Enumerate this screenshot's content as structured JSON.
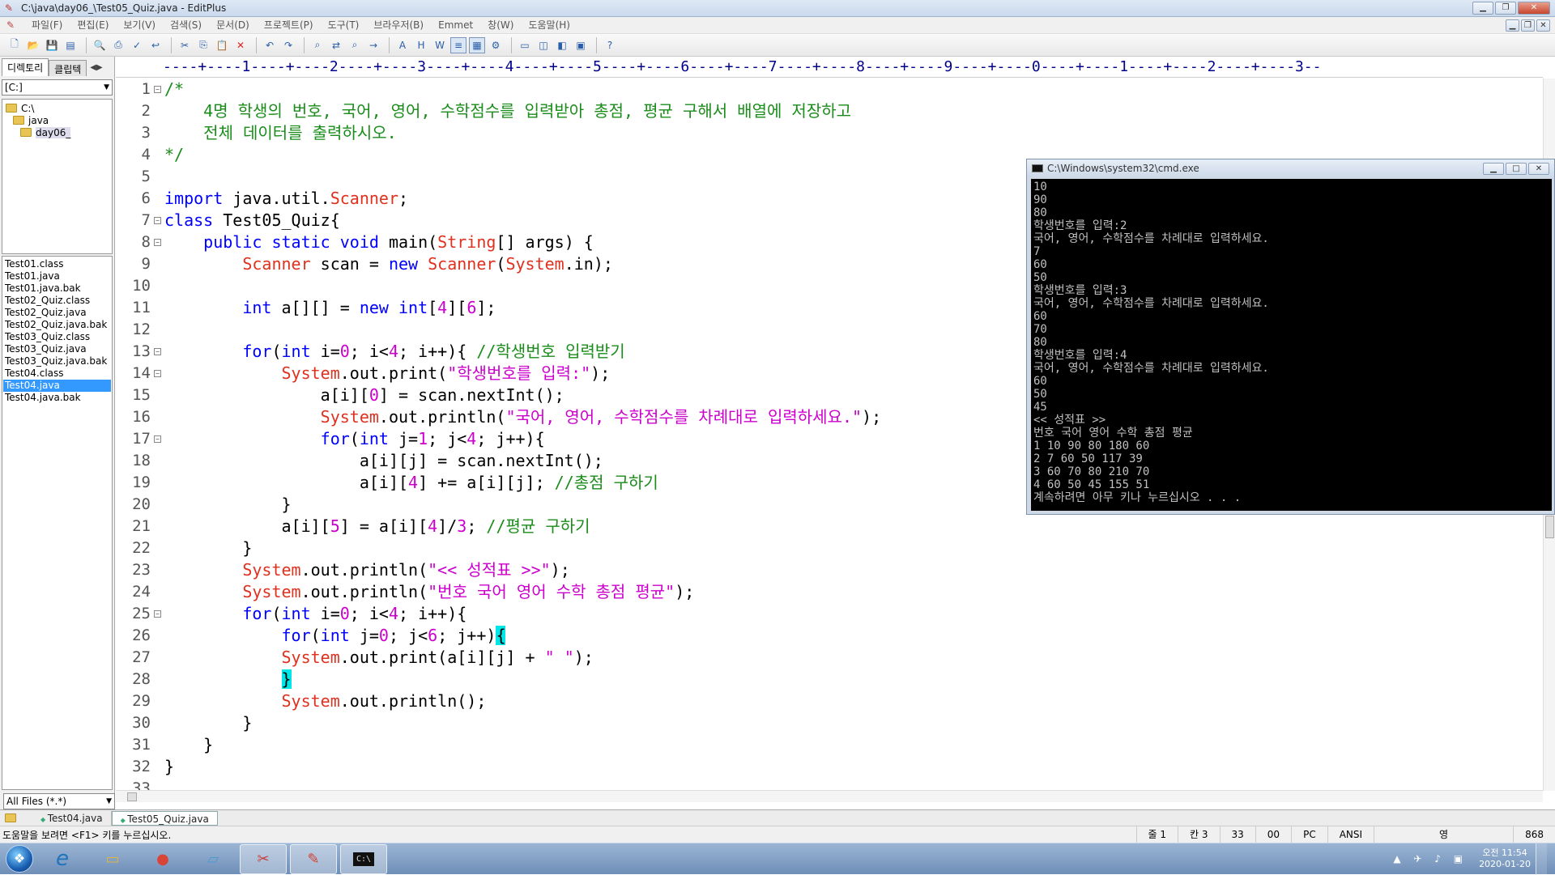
{
  "window": {
    "title": "C:\\java\\day06_\\Test05_Quiz.java - EditPlus",
    "icon": "editplus-pencil-icon"
  },
  "menu": [
    "파일(F)",
    "편집(E)",
    "보기(V)",
    "검색(S)",
    "문서(D)",
    "프로젝트(P)",
    "도구(T)",
    "브라우저(B)",
    "Emmet",
    "창(W)",
    "도움말(H)"
  ],
  "toolbar": {
    "icons": [
      "new-file-icon",
      "open-file-icon",
      "save-icon",
      "save-all-icon",
      "sep",
      "print-preview-icon",
      "print-icon",
      "spell-check-icon",
      "word-wrap-icon",
      "sep",
      "cut-icon",
      "copy-icon",
      "paste-icon",
      "delete-icon",
      "sep",
      "undo-icon",
      "redo-icon",
      "sep",
      "find-icon",
      "replace-icon",
      "find-in-files-icon",
      "goto-icon",
      "sep",
      "font-icon",
      "hex-icon",
      "wordwrap-icon",
      "line-number-icon",
      "column-select-icon",
      "settings-icon",
      "sep",
      "layout-icon",
      "split-icon",
      "browser-icon",
      "output-icon",
      "sep",
      "help-icon"
    ]
  },
  "sidebar": {
    "tabs": [
      "디렉토리",
      "클립텍"
    ],
    "tab_nav": "◀▶",
    "drive": "[C:]",
    "tree": [
      {
        "label": "C:\\",
        "level": 0
      },
      {
        "label": "java",
        "level": 1
      },
      {
        "label": "day06_",
        "level": 2
      }
    ],
    "files": [
      "Test01.class",
      "Test01.java",
      "Test01.java.bak",
      "Test02_Quiz.class",
      "Test02_Quiz.java",
      "Test02_Quiz.java.bak",
      "Test03_Quiz.class",
      "Test03_Quiz.java",
      "Test03_Quiz.java.bak",
      "Test04.class",
      "Test04.java",
      "Test04.java.bak"
    ],
    "selected_file": "Test04.java",
    "filter": "All Files (*.*)"
  },
  "editor": {
    "ruler": "----+----1----+----2----+----3----+----4----+----5----+----6----+----7----+----8----+----9----+----0----+----1----+----2----+----3--",
    "line_numbers": [
      "1",
      "2",
      "3",
      "4",
      "5",
      "6",
      "7",
      "8",
      "9",
      "10",
      "11",
      "12",
      "13",
      "14",
      "15",
      "16",
      "17",
      "18",
      "19",
      "20",
      "21",
      "22",
      "23",
      "24",
      "25",
      "26",
      "27",
      "28",
      "29",
      "30",
      "31",
      "32",
      "33"
    ],
    "fold_lines": [
      1,
      7,
      8,
      13,
      14,
      17,
      25
    ],
    "lines": [
      [
        [
          "cm",
          "/*"
        ]
      ],
      [
        [
          "cm",
          "    4명 학생의 번호, 국어, 영어, 수학점수를 입력받아 총점, 평균 구해서 배열에 저장하고"
        ]
      ],
      [
        [
          "cm",
          "    전체 데이터를 출력하시오."
        ]
      ],
      [
        [
          "cm",
          "*/"
        ]
      ],
      [],
      [
        [
          "kw",
          "import"
        ],
        [
          "p",
          " java.util."
        ],
        [
          "cls",
          "Scanner"
        ],
        [
          "p",
          ";"
        ]
      ],
      [
        [
          "kw",
          "class"
        ],
        [
          "p",
          " Test05_Quiz{"
        ]
      ],
      [
        [
          "p",
          "    "
        ],
        [
          "kw",
          "public static void"
        ],
        [
          "p",
          " main("
        ],
        [
          "cls",
          "String"
        ],
        [
          "p",
          "[] args) {"
        ]
      ],
      [
        [
          "p",
          "        "
        ],
        [
          "cls",
          "Scanner"
        ],
        [
          "p",
          " scan = "
        ],
        [
          "kw",
          "new"
        ],
        [
          "p",
          " "
        ],
        [
          "cls",
          "Scanner"
        ],
        [
          "p",
          "("
        ],
        [
          "cls",
          "System"
        ],
        [
          "p",
          ".in);"
        ]
      ],
      [],
      [
        [
          "p",
          "        "
        ],
        [
          "kw",
          "int"
        ],
        [
          "p",
          " a[][] = "
        ],
        [
          "kw",
          "new int"
        ],
        [
          "p",
          "["
        ],
        [
          "num",
          "4"
        ],
        [
          "p",
          "]["
        ],
        [
          "num",
          "6"
        ],
        [
          "p",
          "];"
        ]
      ],
      [],
      [
        [
          "p",
          "        "
        ],
        [
          "kw",
          "for"
        ],
        [
          "p",
          "("
        ],
        [
          "kw",
          "int"
        ],
        [
          "p",
          " i="
        ],
        [
          "num",
          "0"
        ],
        [
          "p",
          "; i<"
        ],
        [
          "num",
          "4"
        ],
        [
          "p",
          "; i++){ "
        ],
        [
          "cm",
          "//학생번호 입력받기"
        ]
      ],
      [
        [
          "p",
          "            "
        ],
        [
          "cls",
          "System"
        ],
        [
          "p",
          ".out.print("
        ],
        [
          "str",
          "\"학생번호를 입력:\""
        ],
        [
          "p",
          ");"
        ]
      ],
      [
        [
          "p",
          "                a[i]["
        ],
        [
          "num",
          "0"
        ],
        [
          "p",
          "] = scan.nextInt();"
        ]
      ],
      [
        [
          "p",
          "                "
        ],
        [
          "cls",
          "System"
        ],
        [
          "p",
          ".out.println("
        ],
        [
          "str",
          "\"국어, 영어, 수학점수를 차례대로 입력하세요.\""
        ],
        [
          "p",
          ");"
        ]
      ],
      [
        [
          "p",
          "                "
        ],
        [
          "kw",
          "for"
        ],
        [
          "p",
          "("
        ],
        [
          "kw",
          "int"
        ],
        [
          "p",
          " j="
        ],
        [
          "num",
          "1"
        ],
        [
          "p",
          "; j<"
        ],
        [
          "num",
          "4"
        ],
        [
          "p",
          "; j++){"
        ]
      ],
      [
        [
          "p",
          "                    a[i][j] = scan.nextInt();"
        ]
      ],
      [
        [
          "p",
          "                    a[i]["
        ],
        [
          "num",
          "4"
        ],
        [
          "p",
          "] += a[i][j]; "
        ],
        [
          "cm",
          "//총점 구하기"
        ]
      ],
      [
        [
          "p",
          "            }"
        ]
      ],
      [
        [
          "p",
          "            a[i]["
        ],
        [
          "num",
          "5"
        ],
        [
          "p",
          "] = a[i]["
        ],
        [
          "num",
          "4"
        ],
        [
          "p",
          "]/"
        ],
        [
          "num",
          "3"
        ],
        [
          "p",
          "; "
        ],
        [
          "cm",
          "//평균 구하기"
        ]
      ],
      [
        [
          "p",
          "        }"
        ]
      ],
      [
        [
          "p",
          "        "
        ],
        [
          "cls",
          "System"
        ],
        [
          "p",
          ".out.println("
        ],
        [
          "str",
          "\"<< 성적표 >>\""
        ],
        [
          "p",
          ");"
        ]
      ],
      [
        [
          "p",
          "        "
        ],
        [
          "cls",
          "System"
        ],
        [
          "p",
          ".out.println("
        ],
        [
          "str",
          "\"번호 국어 영어 수학 총점 평균\""
        ],
        [
          "p",
          ");"
        ]
      ],
      [
        [
          "p",
          "        "
        ],
        [
          "kw",
          "for"
        ],
        [
          "p",
          "("
        ],
        [
          "kw",
          "int"
        ],
        [
          "p",
          " i="
        ],
        [
          "num",
          "0"
        ],
        [
          "p",
          "; i<"
        ],
        [
          "num",
          "4"
        ],
        [
          "p",
          "; i++){"
        ]
      ],
      [
        [
          "p",
          "            "
        ],
        [
          "kw",
          "for"
        ],
        [
          "p",
          "("
        ],
        [
          "kw",
          "int"
        ],
        [
          "p",
          " j="
        ],
        [
          "num",
          "0"
        ],
        [
          "p",
          "; j<"
        ],
        [
          "num",
          "6"
        ],
        [
          "p",
          "; j++)"
        ],
        [
          "hl",
          "{"
        ]
      ],
      [
        [
          "p",
          "            "
        ],
        [
          "cls",
          "System"
        ],
        [
          "p",
          ".out.print(a[i][j] + "
        ],
        [
          "str",
          "\" \""
        ],
        [
          "p",
          ");"
        ]
      ],
      [
        [
          "p",
          "            "
        ],
        [
          "hl",
          "}"
        ]
      ],
      [
        [
          "p",
          "            "
        ],
        [
          "cls",
          "System"
        ],
        [
          "p",
          ".out.println();"
        ]
      ],
      [
        [
          "p",
          "        }"
        ]
      ],
      [
        [
          "p",
          "    }"
        ]
      ],
      [
        [
          "p",
          "}"
        ]
      ],
      []
    ]
  },
  "console": {
    "title": "C:\\Windows\\system32\\cmd.exe",
    "lines": [
      "10",
      "90",
      "80",
      "학생번호를 입력:2",
      "국어, 영어, 수학점수를 차례대로 입력하세요.",
      "7",
      "60",
      "50",
      "학생번호를 입력:3",
      "국어, 영어, 수학점수를 차례대로 입력하세요.",
      "60",
      "70",
      "80",
      "학생번호를 입력:4",
      "국어, 영어, 수학점수를 차례대로 입력하세요.",
      "60",
      "50",
      "45",
      "<< 성적표 >>",
      "번호 국어 영어 수학 총점 평균",
      "1 10 90 80 180 60",
      "2 7 60 50 117 39",
      "3 60 70 80 210 70",
      "4 60 50 45 155 51",
      "계속하려면 아무 키나 누르십시오 . . ."
    ]
  },
  "doc_tabs": [
    {
      "label": "Test04.java",
      "active": false
    },
    {
      "label": "Test05_Quiz.java",
      "active": true
    }
  ],
  "status": {
    "hint": "도움말을 보려면 <F1> 키를 누르십시오.",
    "line": "줄 1",
    "col": "칸 3",
    "chars": "33",
    "code": "00",
    "eol": "PC",
    "encoding": "ANSI",
    "ime": "영",
    "extra": "868"
  },
  "taskbar": {
    "apps": [
      {
        "name": "ie-icon",
        "glyph": "e",
        "color": "#1e73be",
        "active": false
      },
      {
        "name": "explorer-folder-icon",
        "glyph": "▭",
        "color": "#e2b440",
        "active": false
      },
      {
        "name": "chrome-icon",
        "glyph": "●",
        "color": "#d84436",
        "active": false
      },
      {
        "name": "notepad-icon",
        "glyph": "▱",
        "color": "#4a9ad4",
        "active": false
      },
      {
        "name": "paint-scissors-icon",
        "glyph": "✂",
        "color": "#c83d3d",
        "active": true
      },
      {
        "name": "editplus-icon",
        "glyph": "✎",
        "color": "#d44030",
        "active": true
      },
      {
        "name": "cmd-icon",
        "glyph": "C:\\",
        "color": "#111111",
        "active": true
      }
    ],
    "tray": "▲ ✈ ♪ ▣",
    "time": "오전 11:54",
    "date": "2020-01-20"
  }
}
